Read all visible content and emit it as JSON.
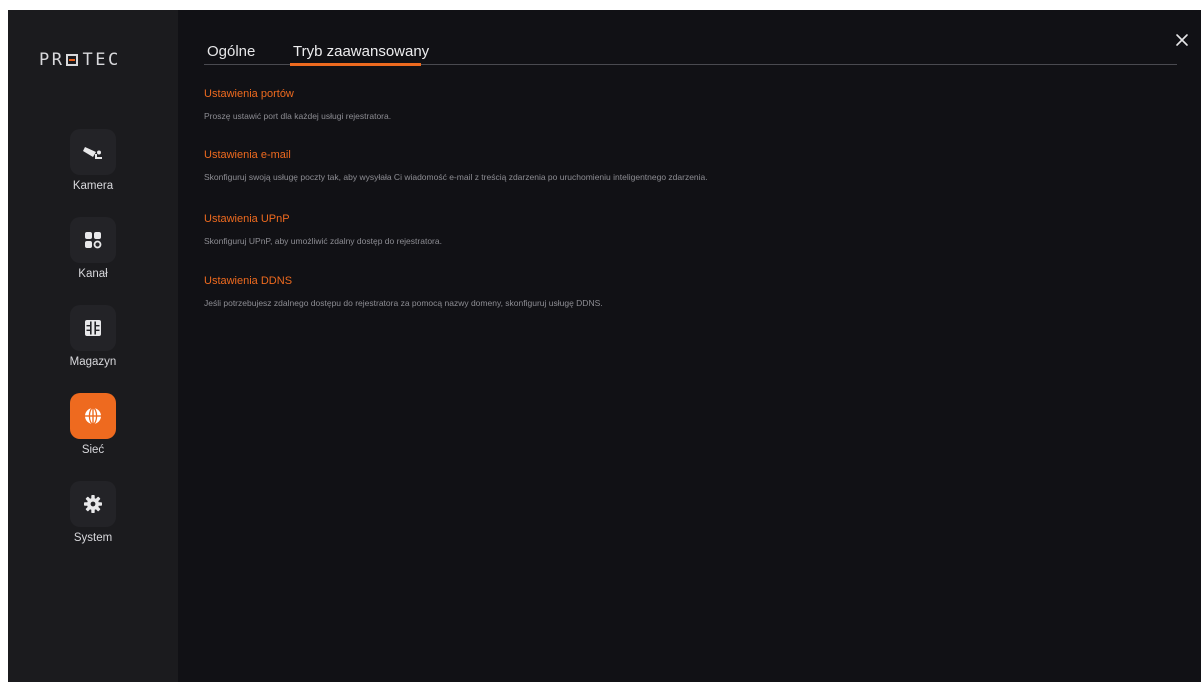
{
  "brand": {
    "logo_text_before": "PR",
    "logo_text_after": "TEC"
  },
  "sidebar": {
    "items": [
      {
        "label": "Kamera",
        "icon": "camera-icon",
        "active": false
      },
      {
        "label": "Kanał",
        "icon": "channel-grid-icon",
        "active": false
      },
      {
        "label": "Magazyn",
        "icon": "storage-icon",
        "active": false
      },
      {
        "label": "Sieć",
        "icon": "network-globe-icon",
        "active": true
      },
      {
        "label": "System",
        "icon": "gear-icon",
        "active": false
      }
    ]
  },
  "tabs": [
    {
      "label": "Ogólne",
      "active": false
    },
    {
      "label": "Tryb zaawansowany",
      "active": true
    }
  ],
  "sections": [
    {
      "title": "Ustawienia portów",
      "description": "Proszę ustawić port dla każdej usługi rejestratora."
    },
    {
      "title": "Ustawienia e-mail",
      "description": "Skonfiguruj swoją usługę poczty tak, aby wysyłała Ci wiadomość e-mail z treścią zdarzenia po uruchomieniu inteligentnego zdarzenia."
    },
    {
      "title": "Ustawienia UPnP",
      "description": "Skonfiguruj UPnP, aby umożliwić zdalny dostęp do rejestratora."
    },
    {
      "title": "Ustawienia DDNS",
      "description": "Jeśli potrzebujesz zdalnego dostępu do rejestratora za pomocą nazwy domeny, skonfiguruj usługę DDNS."
    }
  ],
  "colors": {
    "accent": "#ee6a1f",
    "background": "#111115",
    "sidebar": "#1b1b1e"
  }
}
